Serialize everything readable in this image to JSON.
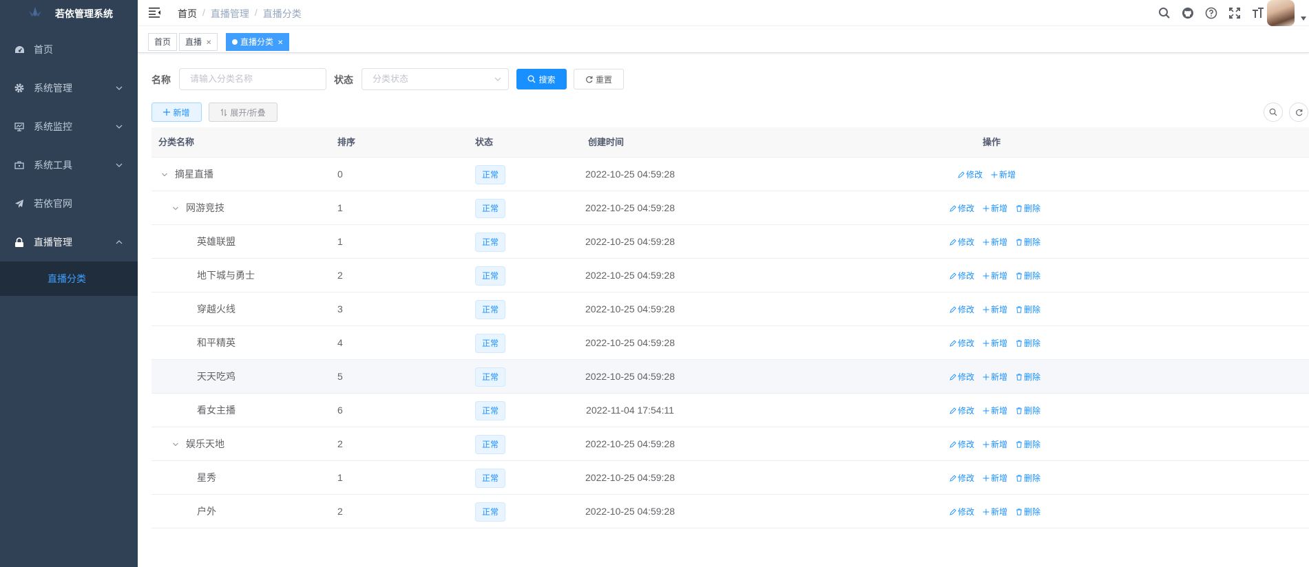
{
  "sidebar": {
    "app_title": "若依管理系统",
    "items": [
      {
        "label": "首页",
        "icon": "dashboard-icon"
      },
      {
        "label": "系统管理",
        "icon": "gear-icon"
      },
      {
        "label": "系统监控",
        "icon": "monitor-icon"
      },
      {
        "label": "系统工具",
        "icon": "toolbox-icon"
      },
      {
        "label": "若依官网",
        "icon": "send-icon"
      },
      {
        "label": "直播管理",
        "icon": "lock-icon"
      }
    ],
    "active_sub": "直播分类"
  },
  "navbar": {
    "breadcrumb": [
      "首页",
      "直播管理",
      "直播分类"
    ]
  },
  "tags": [
    {
      "label": "首页",
      "closable": false
    },
    {
      "label": "直播",
      "closable": true
    },
    {
      "label": "直播分类",
      "closable": true,
      "active": true
    }
  ],
  "search": {
    "name_label": "名称",
    "name_placeholder": "请输入分类名称",
    "status_label": "状态",
    "status_placeholder": "分类状态",
    "search_btn": "搜索",
    "reset_btn": "重置"
  },
  "toolbar": {
    "add_btn": "新增",
    "expand_btn": "展开/折叠"
  },
  "table": {
    "headers": [
      "分类名称",
      "排序",
      "状态",
      "创建时间",
      "操作"
    ],
    "rows": [
      {
        "name": "摘星直播",
        "sort": "0",
        "status": "正常",
        "time": "2022-10-25 04:59:28",
        "level": 0,
        "expandable": true,
        "ops": [
          "修改",
          "新增"
        ]
      },
      {
        "name": "网游竞技",
        "sort": "1",
        "status": "正常",
        "time": "2022-10-25 04:59:28",
        "level": 1,
        "expandable": true,
        "ops": [
          "修改",
          "新增",
          "删除"
        ]
      },
      {
        "name": "英雄联盟",
        "sort": "1",
        "status": "正常",
        "time": "2022-10-25 04:59:28",
        "level": 2,
        "expandable": false,
        "ops": [
          "修改",
          "新增",
          "删除"
        ]
      },
      {
        "name": "地下城与勇士",
        "sort": "2",
        "status": "正常",
        "time": "2022-10-25 04:59:28",
        "level": 2,
        "expandable": false,
        "ops": [
          "修改",
          "新增",
          "删除"
        ]
      },
      {
        "name": "穿越火线",
        "sort": "3",
        "status": "正常",
        "time": "2022-10-25 04:59:28",
        "level": 2,
        "expandable": false,
        "ops": [
          "修改",
          "新增",
          "删除"
        ]
      },
      {
        "name": "和平精英",
        "sort": "4",
        "status": "正常",
        "time": "2022-10-25 04:59:28",
        "level": 2,
        "expandable": false,
        "ops": [
          "修改",
          "新增",
          "删除"
        ]
      },
      {
        "name": "天天吃鸡",
        "sort": "5",
        "status": "正常",
        "time": "2022-10-25 04:59:28",
        "level": 2,
        "expandable": false,
        "ops": [
          "修改",
          "新增",
          "删除"
        ],
        "hover": true
      },
      {
        "name": "看女主播",
        "sort": "6",
        "status": "正常",
        "time": "2022-11-04 17:54:11",
        "level": 2,
        "expandable": false,
        "ops": [
          "修改",
          "新增",
          "删除"
        ]
      },
      {
        "name": "娱乐天地",
        "sort": "2",
        "status": "正常",
        "time": "2022-10-25 04:59:28",
        "level": 1,
        "expandable": true,
        "ops": [
          "修改",
          "新增",
          "删除"
        ]
      },
      {
        "name": "星秀",
        "sort": "1",
        "status": "正常",
        "time": "2022-10-25 04:59:28",
        "level": 2,
        "expandable": false,
        "ops": [
          "修改",
          "新增",
          "删除"
        ]
      },
      {
        "name": "户外",
        "sort": "2",
        "status": "正常",
        "time": "2022-10-25 04:59:28",
        "level": 2,
        "expandable": false,
        "ops": [
          "修改",
          "新增",
          "删除"
        ]
      }
    ]
  },
  "colors": {
    "sidebar_bg": "#304156",
    "primary": "#1890ff",
    "active_sub": "#409eff"
  }
}
